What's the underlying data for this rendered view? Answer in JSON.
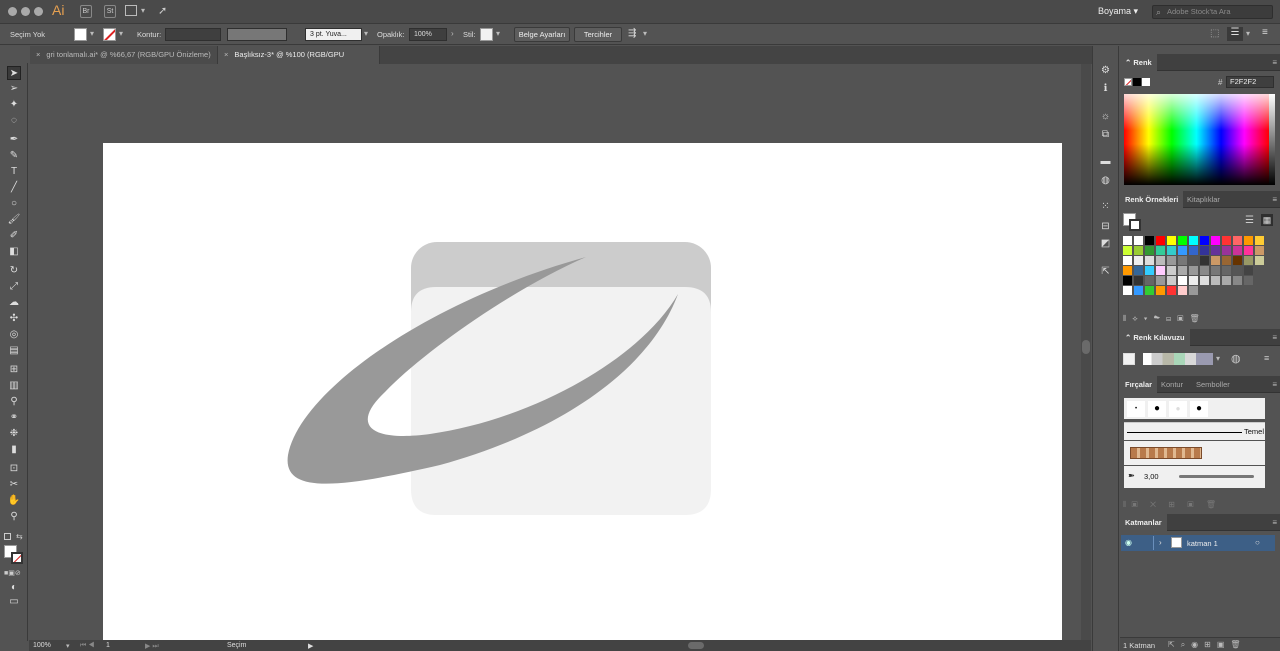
{
  "appbar": {
    "logo": "Ai",
    "br_label": "Br",
    "st_label": "St",
    "workspace": "Boyama",
    "stock_placeholder": "Adobe Stock'ta Ara"
  },
  "control": {
    "selection": "Seçim Yok",
    "stroke_label": "Kontur:",
    "brush_size": "3 pt. Yuva...",
    "opacity_label": "Opaklık:",
    "opacity_value": "100%",
    "style_label": "Stil:",
    "doc_setup": "Belge Ayarları",
    "prefs": "Tercihler"
  },
  "tabs": [
    {
      "label": "gri tonlamalı.ai* @ %66,67 (RGB/GPU Önizleme)"
    },
    {
      "label": "Başlıksız-3* @ %100 (RGB/GPU Önizleme)"
    }
  ],
  "status": {
    "zoom": "100%",
    "artboard_num": "1",
    "tool": "Seçim"
  },
  "panels": {
    "color_title": "Renk",
    "hex": "F2F2F2",
    "swatches_tab": "Renk Örnekleri",
    "libraries_tab": "Kitaplıklar",
    "guide_title": "Renk Kılavuzu",
    "brushes_tab": "Fırçalar",
    "stroke_tab": "Kontur",
    "symbols_tab": "Semboller",
    "brush_basic": "Temel",
    "brush_size": "3,00",
    "layers_title": "Katmanlar",
    "layer_name": "katman 1",
    "layers_count": "1 Katman"
  },
  "colors": {
    "shape_back": "#cccccc",
    "shape_front": "#f2f2f2",
    "swoosh": "#999999",
    "layer_sel": "#3d5f86"
  },
  "icons": [
    "close-icon",
    "minimize-icon",
    "zoom-icon",
    "search-icon",
    "chevron-down-icon",
    "eye-icon"
  ]
}
